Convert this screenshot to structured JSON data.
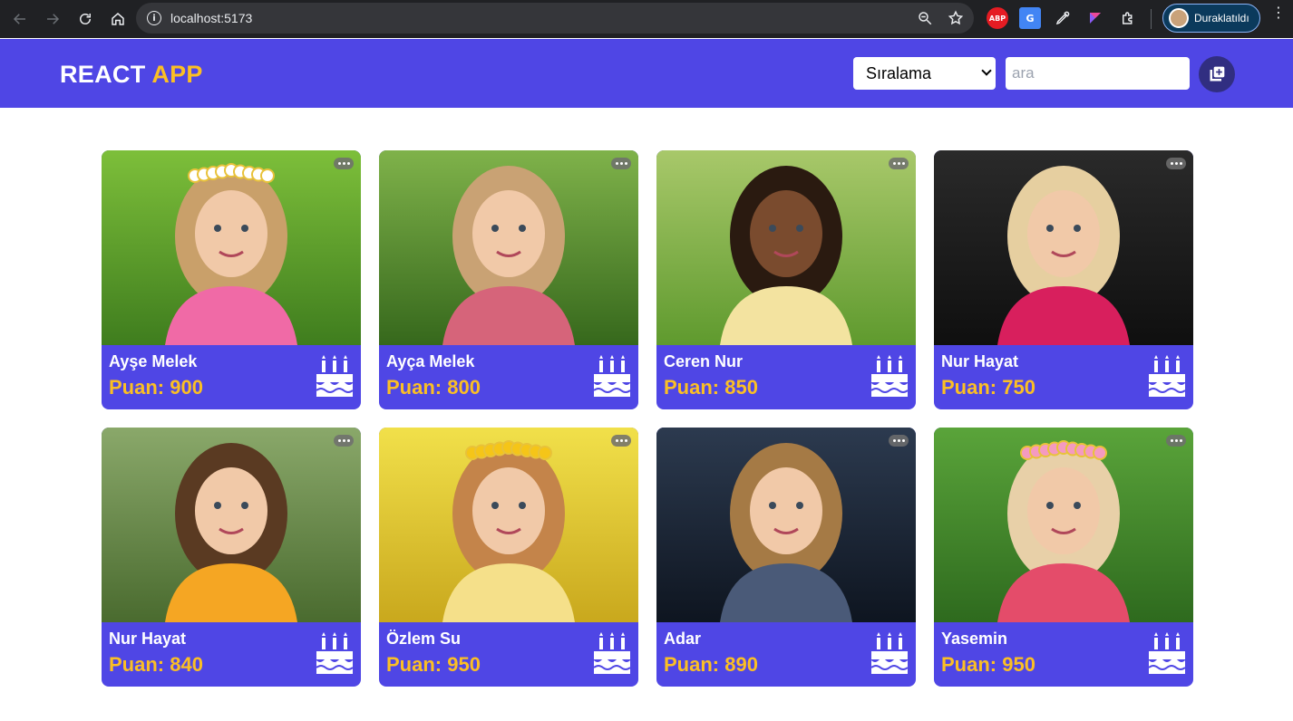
{
  "browser": {
    "url": "localhost:5173",
    "profile_name": "Duraklatıldı",
    "extensions": {
      "abp": "ABP",
      "translate": "G"
    }
  },
  "header": {
    "brand_main": "REACT",
    "brand_accent": "APP",
    "sort_label": "Sıralama",
    "search_placeholder": "ara",
    "colors": {
      "bar": "#4f46e5",
      "accent": "#fbbf24",
      "button": "#312e81"
    }
  },
  "cards": [
    {
      "name": "Ayşe Melek",
      "score": "Puan: 900",
      "photo_theme": "flower-crown-girl-green"
    },
    {
      "name": "Ayça Melek",
      "score": "Puan: 800",
      "photo_theme": "blonde-girl-green"
    },
    {
      "name": "Ceren Nur",
      "score": "Puan: 850",
      "photo_theme": "curly-girl-grass"
    },
    {
      "name": "Nur Hayat",
      "score": "Puan: 750",
      "photo_theme": "blonde-girl-pink-dress"
    },
    {
      "name": "Nur Hayat",
      "score": "Puan: 840",
      "photo_theme": "toddler-orange-overalls"
    },
    {
      "name": "Özlem Su",
      "score": "Puan: 950",
      "photo_theme": "girl-dandelion-crown"
    },
    {
      "name": "Adar",
      "score": "Puan: 890",
      "photo_theme": "surprised-baby-boy"
    },
    {
      "name": "Yasemin",
      "score": "Puan: 950",
      "photo_theme": "girl-pink-headband-garden"
    }
  ]
}
